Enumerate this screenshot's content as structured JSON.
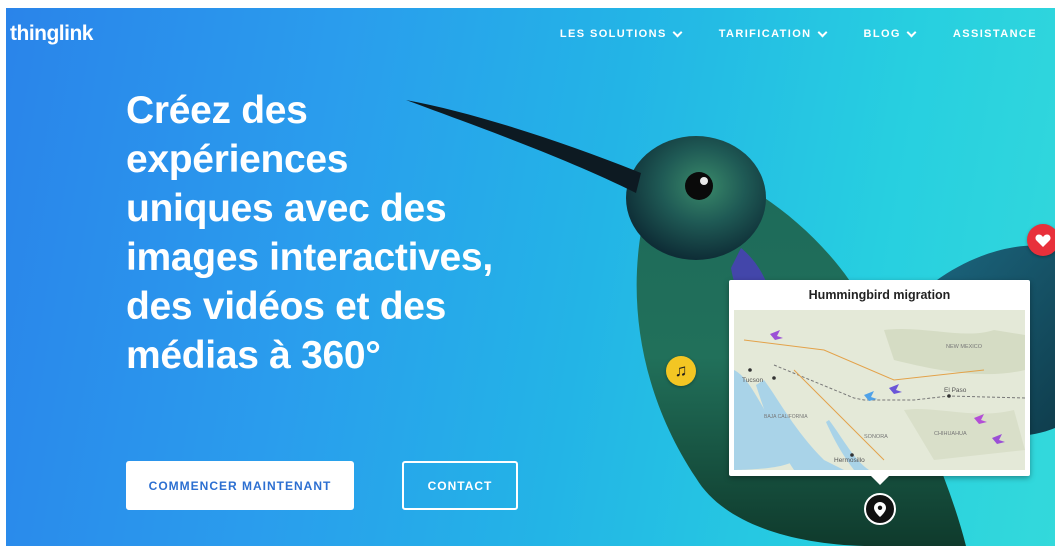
{
  "logo": {
    "text": "thinglink"
  },
  "nav": {
    "items": [
      {
        "label": "LES SOLUTIONS",
        "has_dropdown": true
      },
      {
        "label": "TARIFICATION",
        "has_dropdown": true
      },
      {
        "label": "BLOG",
        "has_dropdown": true
      },
      {
        "label": "ASSISTANCE",
        "has_dropdown": false
      }
    ]
  },
  "hero": {
    "headline_lines": [
      "Créez des",
      "expériences",
      "uniques avec des",
      "images interactives,",
      "des vidéos et des",
      "médias à 360°"
    ],
    "primary_button": "COMMENCER MAINTENANT",
    "secondary_button": "CONTACT"
  },
  "map_card": {
    "title": "Hummingbird migration",
    "place_labels": [
      "Tucson",
      "El Paso",
      "Hermosillo",
      "NEW MEXICO",
      "SONORA",
      "BAJA CALIFORNIA",
      "CHIHUAHUA"
    ]
  },
  "hotspots": {
    "music_icon": "music-note-icon",
    "heart_icon": "heart-icon",
    "pin_icon": "location-pin-icon"
  },
  "colors": {
    "gradient_start": "#2a84ea",
    "gradient_end": "#33d9db",
    "button_text": "#2c6fd1",
    "music_hotspot": "#f3c623",
    "heart_hotspot": "#e8303b"
  }
}
